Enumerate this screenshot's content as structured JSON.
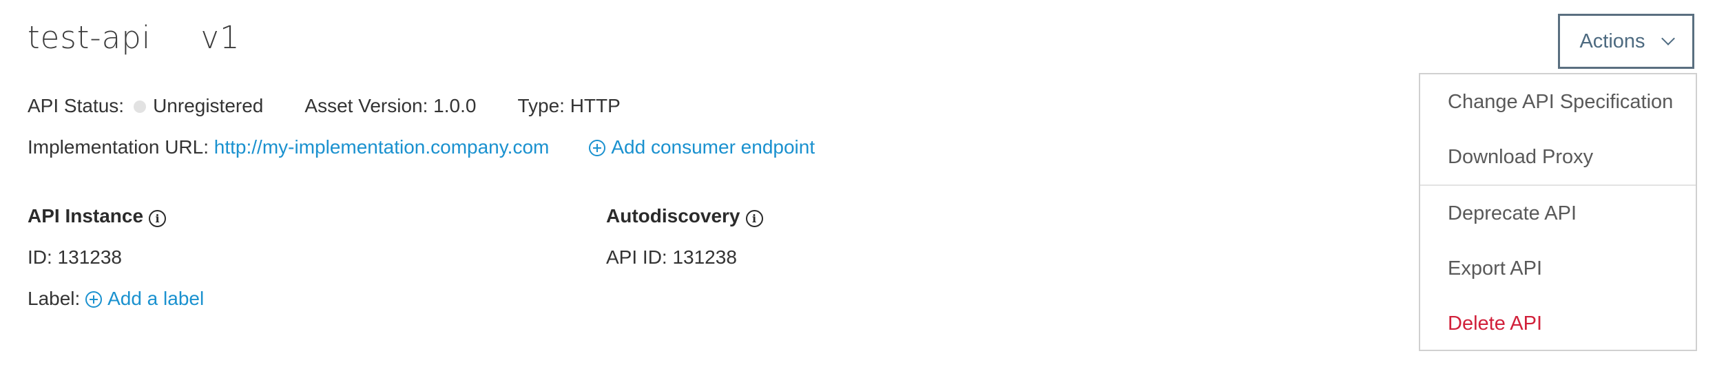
{
  "header": {
    "api_name": "test-api",
    "version": "v1"
  },
  "status_row": {
    "status_label": "API Status:",
    "status_value": "Unregistered",
    "asset_version": "Asset Version: 1.0.0",
    "type": "Type: HTTP"
  },
  "impl_row": {
    "impl_label": "Implementation URL:",
    "impl_url": "http://my-implementation.company.com",
    "add_consumer": "Add consumer endpoint"
  },
  "api_instance": {
    "heading": "API Instance",
    "id": "ID: 131238",
    "label_label": "Label:",
    "add_label": "Add a label"
  },
  "autodiscovery": {
    "heading": "Autodiscovery",
    "api_id": "API ID: 131238"
  },
  "actions": {
    "button_label": "Actions",
    "menu": [
      {
        "label": "Change API Specification"
      },
      {
        "label": "Download Proxy"
      },
      {
        "label": "Deprecate API"
      },
      {
        "label": "Export API"
      },
      {
        "label": "Delete API"
      }
    ]
  },
  "icons": {
    "status_dot": "status-dot-icon",
    "add": "plus-circle-icon",
    "info": "info-icon",
    "chevron": "chevron-down-icon"
  },
  "colors": {
    "link": "#1a91cf",
    "danger": "#d1203a",
    "button_border": "#5a6f80",
    "status_dot": "#e2e2e2"
  }
}
